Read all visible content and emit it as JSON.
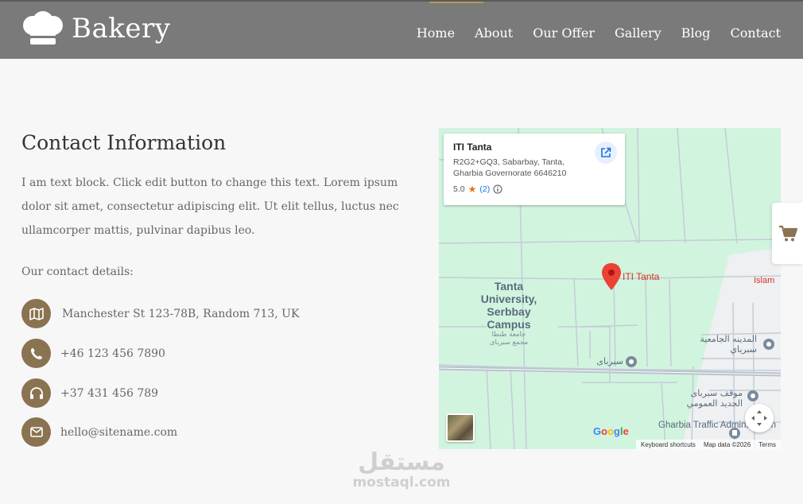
{
  "header": {
    "brand": "Bakery",
    "nav": [
      "Home",
      "About",
      "Our Offer",
      "Gallery",
      "Blog",
      "Contact"
    ]
  },
  "contact": {
    "title": "Contact Information",
    "paragraph": "I am text block. Click edit button to change this text. Lorem ipsum dolor sit amet, consectetur adipiscing elit. Ut elit tellus, luctus nec ullamcorper mattis, pulvinar dapibus leo.",
    "details_label": "Our contact details:",
    "items": [
      {
        "icon": "map-icon",
        "text": "Manchester St 123-78B, Random 713, UK"
      },
      {
        "icon": "phone-icon",
        "text": "+46 123 456 7890"
      },
      {
        "icon": "headphones-icon",
        "text": "+37 431 456 789"
      },
      {
        "icon": "envelope-icon",
        "text": "hello@sitename.com"
      }
    ]
  },
  "map": {
    "place_name": "ITI Tanta",
    "address": "R2G2+GQ3, Sabarbay, Tanta, Gharbia Governorate 6646210",
    "rating": "5.0",
    "review_count": "(2)",
    "pin_label": "ITI Tanta",
    "campus_label": "Tanta University, Serbbay Campus",
    "campus_label_ar": "جامعة طنطا مجمع سبرباى",
    "labels_ar": [
      "المدينه الجامعية سبرباي",
      "سبرباى",
      "موقف سبرباى الجديد العمومي"
    ],
    "islam_label": "Islam",
    "traffic_label": "Gharbia Traffic Adminstration",
    "google": "Google",
    "attribution": [
      "Keyboard shortcuts",
      "Map data ©2026",
      "Terms"
    ]
  },
  "watermark": {
    "arabic": "مستقل",
    "latin": "mostaql.com"
  },
  "colors": {
    "header_bg": "#7a7a7a",
    "accent": "#8a7350",
    "map_bg": "#d1f4df",
    "pin": "#d93025"
  }
}
